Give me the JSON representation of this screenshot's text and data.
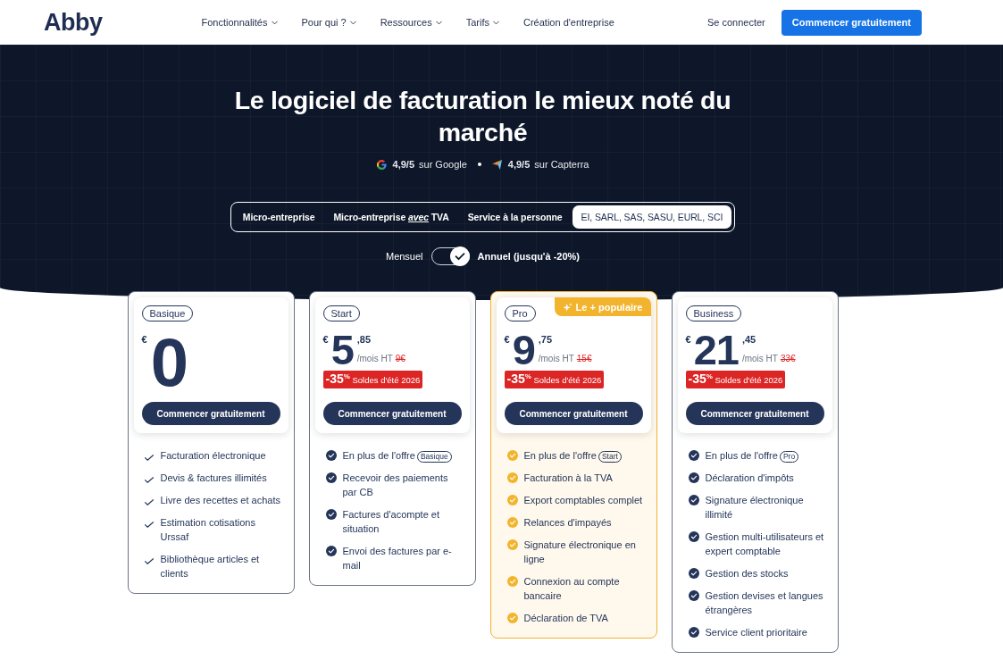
{
  "header": {
    "logo": "Abby",
    "nav": [
      {
        "label": "Fonctionnalités",
        "dropdown": true
      },
      {
        "label": "Pour qui ?",
        "dropdown": true
      },
      {
        "label": "Ressources",
        "dropdown": true
      },
      {
        "label": "Tarifs",
        "dropdown": true
      },
      {
        "label": "Création d'entreprise",
        "dropdown": false
      }
    ],
    "login": "Se connecter",
    "cta": "Commencer gratuitement"
  },
  "hero": {
    "title": "Le logiciel de facturation le mieux noté du marché",
    "ratings": [
      {
        "kind": "google",
        "score": "4,9/5",
        "source": "sur Google"
      },
      {
        "kind": "capterra",
        "score": "4,9/5",
        "source": "sur Capterra"
      }
    ],
    "segments": [
      {
        "label": "Micro-entreprise",
        "selected": false
      },
      {
        "label": "Micro-entreprise *avec* TVA",
        "selected": false
      },
      {
        "label": "Service à la personne",
        "selected": false
      },
      {
        "label": "EI, SARL, SAS, SASU, EURL, SCI",
        "selected": true
      }
    ],
    "billing_toggle": {
      "left_label": "Mensuel",
      "right_label": "Annuel (jusqu'à -20%)",
      "on": true
    }
  },
  "plans": [
    {
      "kind": "free",
      "name": "Basique",
      "price": {
        "currency": "€",
        "amount": "0"
      },
      "cta": "Commencer gratuitement",
      "features": [
        {
          "text": "Facturation électronique"
        },
        {
          "text": "Devis & factures illimités"
        },
        {
          "text": "Livre des recettes et achats"
        },
        {
          "text": "Estimation cotisations Urssaf"
        },
        {
          "text": "Bibliothèque articles et clients"
        }
      ]
    },
    {
      "kind": "standard",
      "name": "Start",
      "price": {
        "currency": "€",
        "amount": "5",
        "cents": ",85",
        "period": "/mois HT",
        "old_price": "9€"
      },
      "sale": "**-35**$^{%}$ Soldes d'été 2026",
      "cta": "Commencer gratuitement",
      "features": [
        {
          "text": "En plus de l'offre",
          "plan": "Basique"
        },
        {
          "text": "Recevoir des paiements par CB"
        },
        {
          "text": "Factures d'acompte et situation"
        },
        {
          "text": "Envoi des factures par e-mail"
        }
      ]
    },
    {
      "kind": "popular",
      "name": "Pro",
      "badge": "Le + populaire",
      "price": {
        "currency": "€",
        "amount": "9",
        "cents": ",75",
        "period": "/mois HT",
        "old_price": "15€"
      },
      "sale": "**-35**$^{%}$ Soldes d'été 2026",
      "cta": "Commencer gratuitement",
      "features": [
        {
          "text": "En plus de l'offre",
          "plan": "Start"
        },
        {
          "text": "Facturation à la TVA"
        },
        {
          "text": "Export comptables complet"
        },
        {
          "text": "Relances d'impayés"
        },
        {
          "text": "Signature électronique en ligne"
        },
        {
          "text": "Connexion au compte bancaire"
        },
        {
          "text": "Déclaration de TVA"
        }
      ]
    },
    {
      "kind": "standard",
      "name": "Business",
      "price": {
        "currency": "€",
        "amount": "21",
        "cents": ",45",
        "period": "/mois HT",
        "old_price": "33€"
      },
      "sale": "**-35**$^{%}$ Soldes d'été 2026",
      "cta": "Commencer gratuitement",
      "features": [
        {
          "text": "En plus de l'offre",
          "plan": "Pro"
        },
        {
          "text": "Déclaration d'impôts"
        },
        {
          "text": "Signature électronique illimité"
        },
        {
          "text": "Gestion multi-utilisateurs et expert comptable"
        },
        {
          "text": "Gestion des stocks"
        },
        {
          "text": "Gestion devises et langues étrangères"
        },
        {
          "text": "Service client prioritaire"
        }
      ]
    }
  ]
}
